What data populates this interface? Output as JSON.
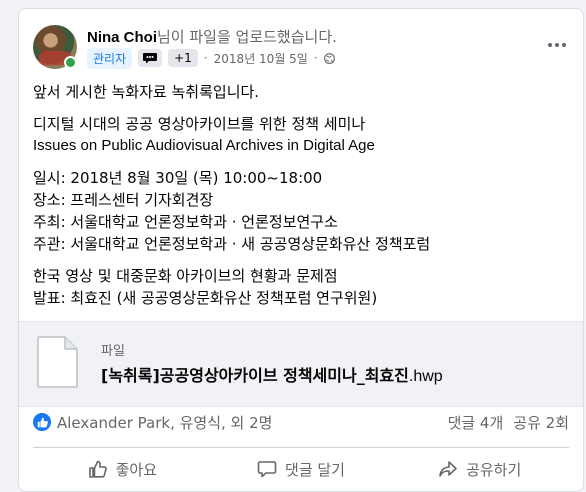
{
  "post": {
    "author": "Nina Choi",
    "action_text": "님이 파일을 업로드했습니다.",
    "admin_badge": "관리자",
    "extra_badge": "+1",
    "timestamp": "2018년 10월 5일",
    "separator": "·",
    "lines": [
      "앞서 게시한 녹화자료 녹취록입니다.",
      "디지털 시대의 공공 영상아카이브를 위한 정책 세미나",
      "Issues on Public Audiovisual Archives in Digital Age",
      "일시: 2018년 8월 30일 (목) 10:00~18:00",
      "장소: 프레스센터 기자회견장",
      "주최: 서울대학교 언론정보학과 · 언론정보연구소",
      "주관: 서울대학교 언론정보학과 · 새 공공영상문화유산 정책포럼",
      "한국 영상 및 대중문화 아카이브의 현황과 문제점",
      "발표: 최효진 (새 공공영상문화유산 정책포럼 연구위원)"
    ]
  },
  "attachment": {
    "kind": "파일",
    "file_name_main": "[녹취록]공공영상아카이브 정책세미나_최효진",
    "file_ext": ".hwp"
  },
  "reactions": {
    "likers": "Alexander Park, 유영식, 외 2명",
    "comments": "댓글 4개",
    "shares": "공유 2회"
  },
  "actions": {
    "like": "좋아요",
    "comment": "댓글 달기",
    "share": "공유하기"
  },
  "colors": {
    "accent": "#1877f2",
    "online": "#31a24c",
    "secondary_text": "#65676b"
  },
  "icons": [
    "globe-icon",
    "more-icon",
    "file-icon",
    "like-icon",
    "comment-icon",
    "share-icon",
    "chat-badge-icon"
  ]
}
